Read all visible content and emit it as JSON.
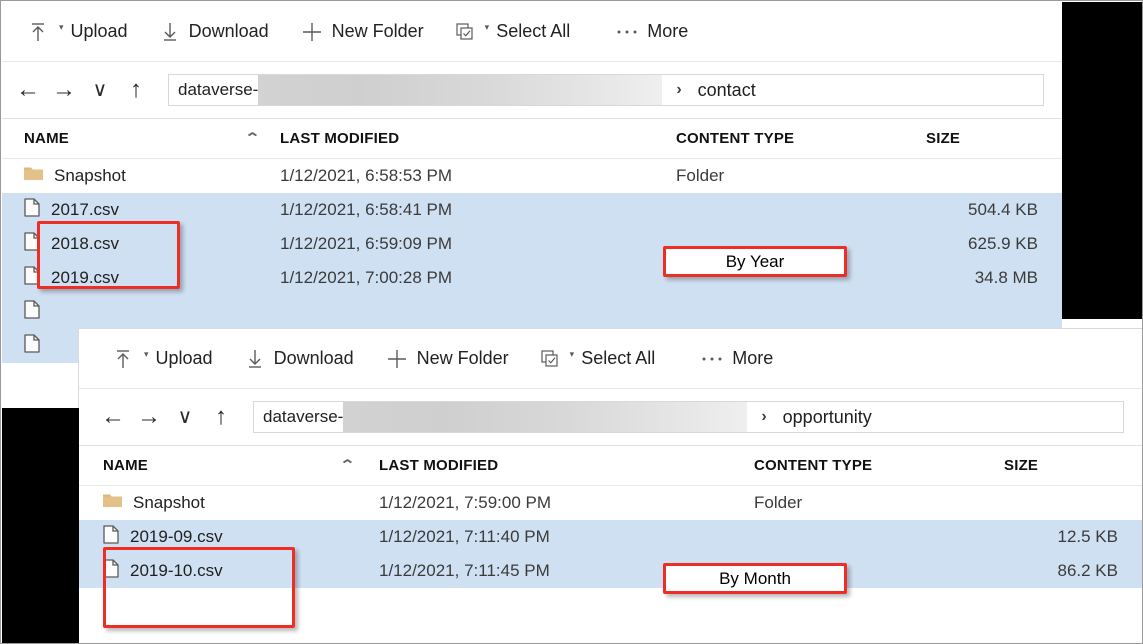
{
  "panels": [
    {
      "id": "contact",
      "toolbar": [
        {
          "icon": "upload-icon",
          "label": "Upload",
          "has_caret": true
        },
        {
          "icon": "download-icon",
          "label": "Download",
          "has_caret": false
        },
        {
          "icon": "new-folder-icon",
          "label": "New Folder",
          "has_caret": false
        },
        {
          "icon": "select-all-icon",
          "label": "Select All",
          "has_caret": true
        },
        {
          "icon": "more-icon",
          "label": "More",
          "has_caret": false
        }
      ],
      "nav": {
        "back": "←",
        "forward": "→",
        "recent": "∨",
        "up": "↑"
      },
      "breadcrumb": {
        "root": "dataverse-",
        "redacted": true,
        "separator": "›",
        "current": "contact"
      },
      "columns": [
        "NAME",
        "LAST MODIFIED",
        "CONTENT TYPE",
        "SIZE"
      ],
      "sorted_column": "NAME",
      "sort_direction": "asc",
      "rows": [
        {
          "icon": "folder-icon",
          "name": "Snapshot",
          "modified": "1/12/2021, 6:58:53 PM",
          "type": "Folder",
          "size": "",
          "selected": false
        },
        {
          "icon": "file-icon",
          "name": "2017.csv",
          "modified": "1/12/2021, 6:58:41 PM",
          "type": "",
          "size": "504.4 KB",
          "selected": true
        },
        {
          "icon": "file-icon",
          "name": "2018.csv",
          "modified": "1/12/2021, 6:59:09 PM",
          "type": "",
          "size": "625.9 KB",
          "selected": true
        },
        {
          "icon": "file-icon",
          "name": "2019.csv",
          "modified": "1/12/2021, 7:00:28 PM",
          "type": "",
          "size": "34.8 MB",
          "selected": true
        },
        {
          "icon": "file-icon",
          "name": "",
          "modified": "",
          "type": "",
          "size": "",
          "selected": true
        },
        {
          "icon": "file-icon",
          "name": "",
          "modified": "",
          "type": "",
          "size": "",
          "selected": true
        }
      ],
      "annotation": {
        "label": "By Year",
        "color": "#ee2d24"
      }
    },
    {
      "id": "opportunity",
      "toolbar": [
        {
          "icon": "upload-icon",
          "label": "Upload",
          "has_caret": true
        },
        {
          "icon": "download-icon",
          "label": "Download",
          "has_caret": false
        },
        {
          "icon": "new-folder-icon",
          "label": "New Folder",
          "has_caret": false
        },
        {
          "icon": "select-all-icon",
          "label": "Select All",
          "has_caret": true
        },
        {
          "icon": "more-icon",
          "label": "More",
          "has_caret": false
        }
      ],
      "nav": {
        "back": "←",
        "forward": "→",
        "recent": "∨",
        "up": "↑"
      },
      "breadcrumb": {
        "root": "dataverse-",
        "redacted": true,
        "separator": "›",
        "current": "opportunity"
      },
      "columns": [
        "NAME",
        "LAST MODIFIED",
        "CONTENT TYPE",
        "SIZE"
      ],
      "sorted_column": "NAME",
      "sort_direction": "asc",
      "rows": [
        {
          "icon": "folder-icon",
          "name": "Snapshot",
          "modified": "1/12/2021, 7:59:00 PM",
          "type": "Folder",
          "size": "",
          "selected": false
        },
        {
          "icon": "file-icon",
          "name": "2019-09.csv",
          "modified": "1/12/2021, 7:11:40 PM",
          "type": "",
          "size": "12.5 KB",
          "selected": true
        },
        {
          "icon": "file-icon",
          "name": "2019-10.csv",
          "modified": "1/12/2021, 7:11:45 PM",
          "type": "",
          "size": "86.2 KB",
          "selected": true
        }
      ],
      "annotation": {
        "label": "By Month",
        "color": "#ee2d24"
      }
    }
  ],
  "colors": {
    "selection": "#cfe0f2",
    "annotation": "#ee2d24",
    "folder": "#dcb67a",
    "redaction": "#000000"
  }
}
